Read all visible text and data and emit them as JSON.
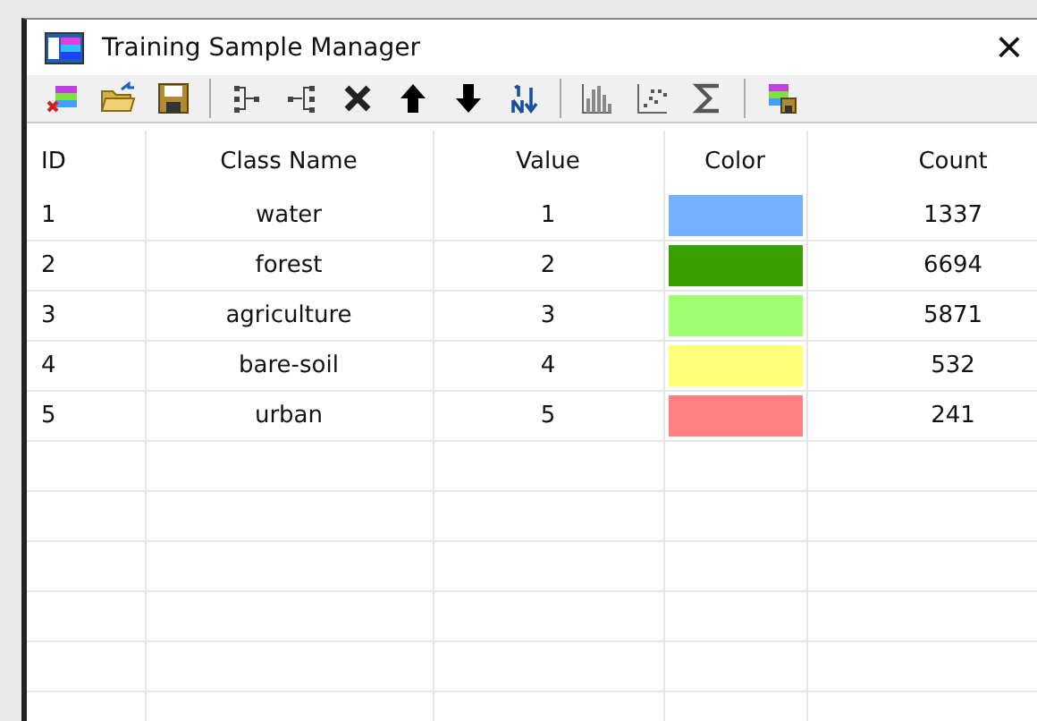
{
  "window": {
    "title": "Training Sample Manager",
    "close": "×"
  },
  "table": {
    "columns": [
      "ID",
      "Class Name",
      "Value",
      "Color",
      "Count"
    ],
    "rows": [
      {
        "id": "1",
        "class_name": "water",
        "value": "1",
        "color": "#74b0ff",
        "count": "1337"
      },
      {
        "id": "2",
        "class_name": "forest",
        "value": "2",
        "color": "#38a000",
        "count": "6694"
      },
      {
        "id": "3",
        "class_name": "agriculture",
        "value": "3",
        "color": "#a0ff70",
        "count": "5871"
      },
      {
        "id": "4",
        "class_name": "bare-soil",
        "value": "4",
        "color": "#ffff78",
        "count": "532"
      },
      {
        "id": "5",
        "class_name": "urban",
        "value": "5",
        "color": "#ff8080",
        "count": "241"
      }
    ]
  }
}
